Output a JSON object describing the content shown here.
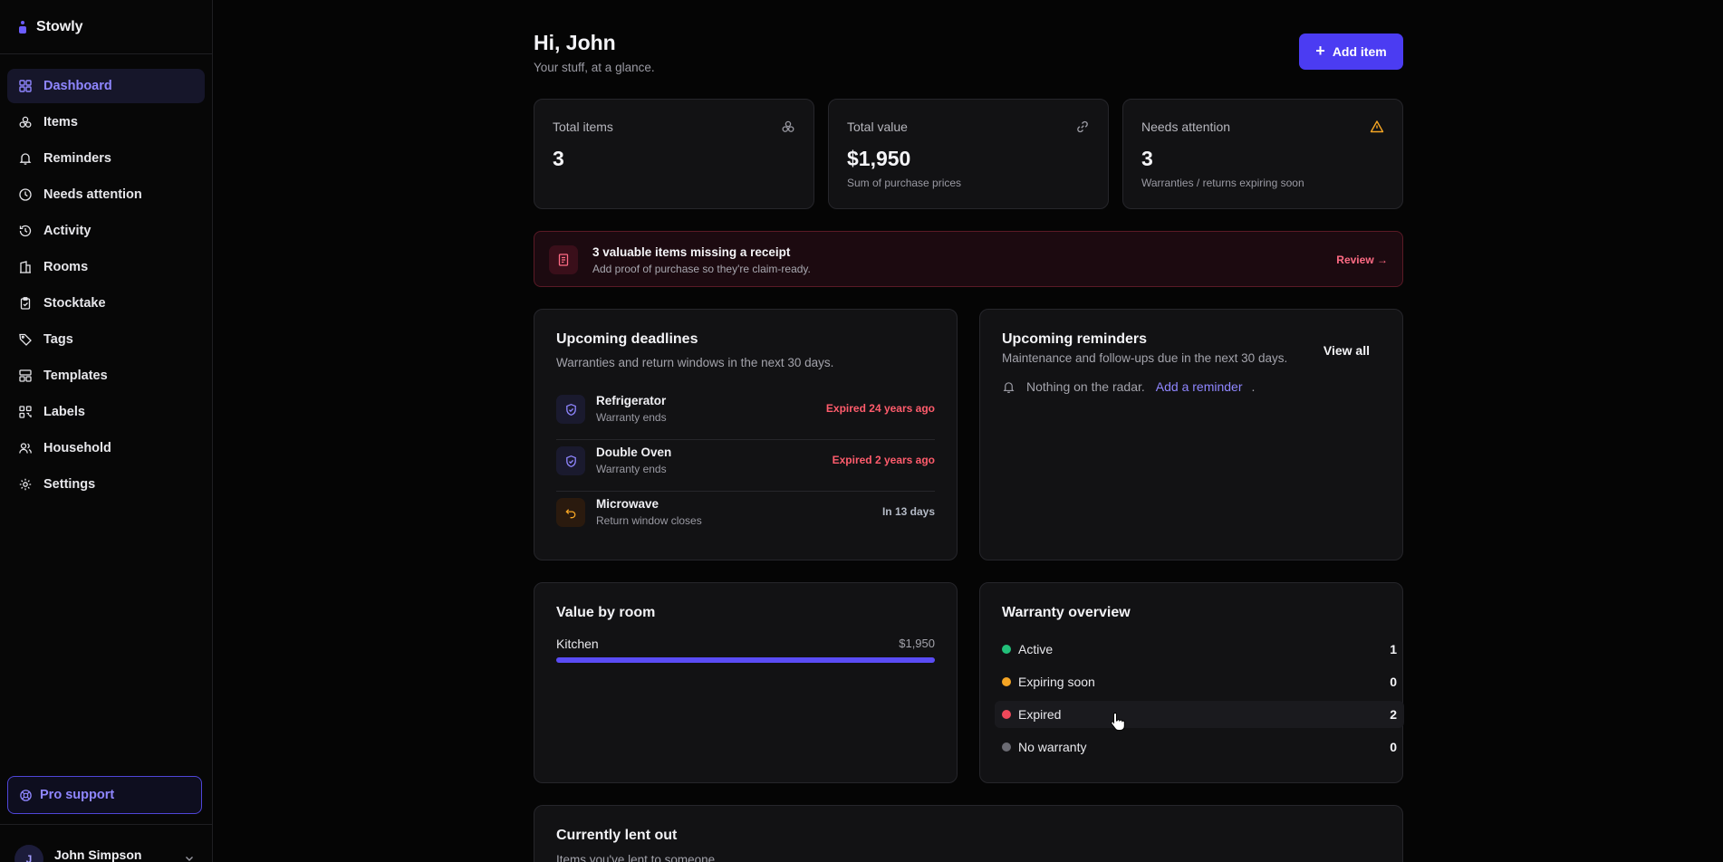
{
  "app": {
    "name": "Stowly"
  },
  "sidebar": {
    "items": [
      {
        "label": "Dashboard",
        "icon": "grid-icon",
        "active": true
      },
      {
        "label": "Items",
        "icon": "boxes-icon"
      },
      {
        "label": "Reminders",
        "icon": "bell-icon"
      },
      {
        "label": "Needs attention",
        "icon": "clock-icon"
      },
      {
        "label": "Activity",
        "icon": "history-icon"
      },
      {
        "label": "Rooms",
        "icon": "building-icon"
      },
      {
        "label": "Stocktake",
        "icon": "clipboard-check-icon"
      },
      {
        "label": "Tags",
        "icon": "tag-icon"
      },
      {
        "label": "Templates",
        "icon": "layout-template-icon"
      },
      {
        "label": "Labels",
        "icon": "qr-code-icon"
      },
      {
        "label": "Household",
        "icon": "users-icon"
      },
      {
        "label": "Settings",
        "icon": "gear-icon"
      }
    ],
    "pro_support": "Pro support",
    "user": {
      "name": "John Simpson",
      "initial": "J"
    }
  },
  "header": {
    "greeting": "Hi, John",
    "subtitle": "Your stuff, at a glance.",
    "add_button": "Add item"
  },
  "stats": [
    {
      "label": "Total items",
      "value": "3",
      "note": "",
      "icon": "boxes-icon"
    },
    {
      "label": "Total value",
      "value": "$1,950",
      "note": "Sum of purchase prices",
      "icon": "link-icon"
    },
    {
      "label": "Needs attention",
      "value": "3",
      "note": "Warranties / returns expiring soon",
      "icon": "warning-icon"
    }
  ],
  "alert": {
    "title": "3 valuable items missing a receipt",
    "description": "Add proof of purchase so they're claim-ready.",
    "link": "Review →"
  },
  "deadlines": {
    "title": "Upcoming deadlines",
    "subtitle": "Warranties and return windows in the next 30 days.",
    "rows": [
      {
        "name": "Refrigerator",
        "kind": "Warranty ends",
        "when": "Expired 24 years ago",
        "status": "expired",
        "icon": "shield-check-icon"
      },
      {
        "name": "Double Oven",
        "kind": "Warranty ends",
        "when": "Expired 2 years ago",
        "status": "expired",
        "icon": "shield-check-icon"
      },
      {
        "name": "Microwave",
        "kind": "Return window closes",
        "when": "In 13 days",
        "status": "soon",
        "icon": "undo-icon"
      }
    ]
  },
  "reminders": {
    "title": "Upcoming reminders",
    "subtitle": "Maintenance and follow-ups due in the next 30 days.",
    "view_all": "View all",
    "empty_text": "Nothing on the radar.",
    "empty_link": "Add a reminder",
    "empty_suffix": "."
  },
  "rooms": {
    "title": "Value by room",
    "rows": [
      {
        "name": "Kitchen",
        "value": "$1,950",
        "share": 1.0
      }
    ]
  },
  "warranty": {
    "title": "Warranty overview",
    "rows": [
      {
        "label": "Active",
        "count": "1",
        "color": "#22c07a"
      },
      {
        "label": "Expiring soon",
        "count": "0",
        "color": "#f5a524"
      },
      {
        "label": "Expired",
        "count": "2",
        "color": "#f0485a"
      },
      {
        "label": "No warranty",
        "count": "0",
        "color": "#6b6b73"
      }
    ]
  },
  "lent": {
    "title": "Currently lent out",
    "subtitle": "Items you've lent to someone."
  }
}
